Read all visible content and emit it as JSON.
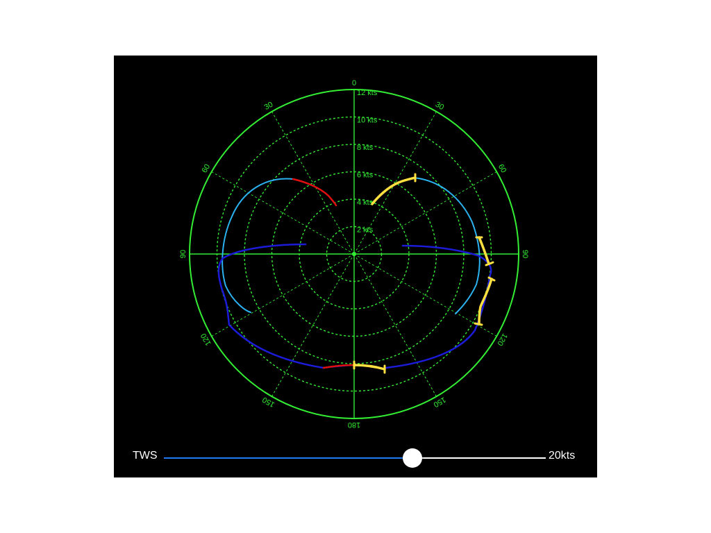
{
  "chart_data": {
    "type": "polar",
    "radial_axis": {
      "unit": "kts",
      "ring_values": [
        2,
        4,
        6,
        8,
        10,
        12
      ],
      "ring_labels": [
        "2 kts",
        "4 kts",
        "6 kts",
        "8 kts",
        "10 kts",
        "12 kts"
      ],
      "max": 12
    },
    "angular_axis": {
      "spokes_deg": [
        0,
        30,
        60,
        90,
        120,
        150,
        180,
        210,
        240,
        270,
        300,
        330
      ],
      "labels": [
        {
          "deg": 0,
          "text": "0"
        },
        {
          "deg": 30,
          "text": "30"
        },
        {
          "deg": 60,
          "text": "60"
        },
        {
          "deg": 90,
          "text": "90"
        },
        {
          "deg": 120,
          "text": "120"
        },
        {
          "deg": 150,
          "text": "150"
        },
        {
          "deg": 180,
          "text": "180"
        },
        {
          "deg": 210,
          "text": "150"
        },
        {
          "deg": 240,
          "text": "120"
        },
        {
          "deg": 270,
          "text": "90"
        },
        {
          "deg": 300,
          "text": "60"
        },
        {
          "deg": 330,
          "text": "30"
        }
      ]
    },
    "grid": true,
    "colors": {
      "background": "#000000",
      "grid": "#33ee33",
      "series_light_blue": "#2bb2f0",
      "series_dark_blue": "#1b1bd8",
      "series_red": "#e01010",
      "series_yellow": "#ffe040"
    }
  },
  "controls": {
    "slider_label": "TWS",
    "slider_value_label": "20kts",
    "slider_fraction": 0.65
  }
}
